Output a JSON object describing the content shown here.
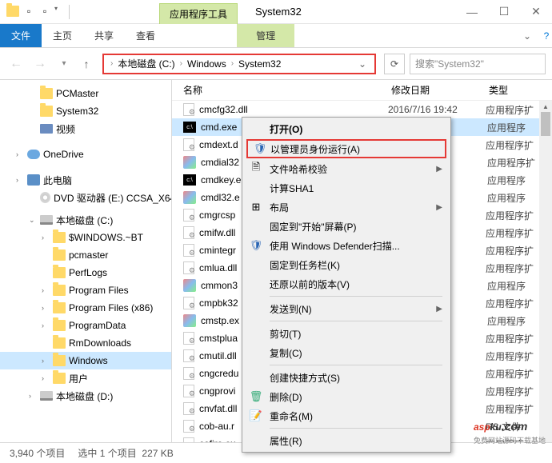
{
  "titlebar": {
    "tools_tab": "应用程序工具",
    "title": "System32"
  },
  "ribbon": {
    "file": "文件",
    "home": "主页",
    "share": "共享",
    "view": "查看",
    "manage": "管理"
  },
  "breadcrumb": {
    "seg1": "本地磁盘 (C:)",
    "seg2": "Windows",
    "seg3": "System32"
  },
  "search": {
    "placeholder": "搜索\"System32\""
  },
  "tree": {
    "pcmaster": "PCMaster",
    "system32": "System32",
    "video": "视频",
    "onedrive": "OneDrive",
    "thispc": "此电脑",
    "dvd": "DVD 驱动器 (E:) CCSA_X64",
    "localdisk": "本地磁盘 (C:)",
    "windowsbt": "$WINDOWS.~BT",
    "pcmaster2": "pcmaster",
    "perflogs": "PerfLogs",
    "progfiles": "Program Files",
    "progfiles86": "Program Files (x86)",
    "programdata": "ProgramData",
    "rmdl": "RmDownloads",
    "windows": "Windows",
    "users": "用户",
    "localdisk_d": "本地磁盘 (D:)"
  },
  "cols": {
    "name": "名称",
    "date": "修改日期",
    "type": "类型"
  },
  "files": [
    {
      "icon": "dll",
      "name": "cmcfg32.dll",
      "date": "2016/7/16 19:42",
      "type": "应用程序扩",
      "sel": false
    },
    {
      "icon": "exe",
      "name": "cmd.exe",
      "date": "",
      "type": "应用程序",
      "sel": true
    },
    {
      "icon": "dll",
      "name": "cmdext.d",
      "date": "",
      "type": "应用程序扩",
      "sel": false
    },
    {
      "icon": "app",
      "name": "cmdial32",
      "date": "",
      "type": "应用程序扩",
      "sel": false
    },
    {
      "icon": "exe",
      "name": "cmdkey.e",
      "date": "",
      "type": "应用程序",
      "sel": false
    },
    {
      "icon": "app",
      "name": "cmdl32.e",
      "date": "",
      "type": "应用程序",
      "sel": false
    },
    {
      "icon": "dll",
      "name": "cmgrcsp",
      "date": "",
      "type": "应用程序扩",
      "sel": false
    },
    {
      "icon": "dll",
      "name": "cmifw.dll",
      "date": "",
      "type": "应用程序扩",
      "sel": false
    },
    {
      "icon": "dll",
      "name": "cmintegr",
      "date": "",
      "type": "应用程序扩",
      "sel": false
    },
    {
      "icon": "dll",
      "name": "cmlua.dll",
      "date": "",
      "type": "应用程序扩",
      "sel": false
    },
    {
      "icon": "app",
      "name": "cmmon3",
      "date": "",
      "type": "应用程序",
      "sel": false
    },
    {
      "icon": "dll",
      "name": "cmpbk32",
      "date": "",
      "type": "应用程序扩",
      "sel": false
    },
    {
      "icon": "app",
      "name": "cmstp.ex",
      "date": "",
      "type": "应用程序",
      "sel": false
    },
    {
      "icon": "dll",
      "name": "cmstplua",
      "date": "",
      "type": "应用程序扩",
      "sel": false
    },
    {
      "icon": "dll",
      "name": "cmutil.dll",
      "date": "",
      "type": "应用程序扩",
      "sel": false
    },
    {
      "icon": "dll",
      "name": "cngcredu",
      "date": "",
      "type": "应用程序扩",
      "sel": false
    },
    {
      "icon": "dll",
      "name": "cngprovi",
      "date": "",
      "type": "应用程序扩",
      "sel": false
    },
    {
      "icon": "dll",
      "name": "cnvfat.dll",
      "date": "",
      "type": "应用程序扩",
      "sel": false
    },
    {
      "icon": "dll",
      "name": "cob-au.r",
      "date": "",
      "type": "RS 文件",
      "sel": false
    },
    {
      "icon": "dll",
      "name": "cofire.ex",
      "date": "",
      "type": "应用程序",
      "sel": false
    }
  ],
  "menu": {
    "open": "打开(O)",
    "runas": "以管理员身份运行(A)",
    "hash": "文件哈希校验",
    "sha1": "计算SHA1",
    "layout": "布局",
    "pin_start": "固定到\"开始\"屏幕(P)",
    "defender": "使用 Windows Defender扫描...",
    "pin_taskbar": "固定到任务栏(K)",
    "restore": "还原以前的版本(V)",
    "sendto": "发送到(N)",
    "cut": "剪切(T)",
    "copy": "复制(C)",
    "shortcut": "创建快捷方式(S)",
    "delete": "删除(D)",
    "rename": "重命名(M)",
    "props": "属性(R)"
  },
  "status": {
    "count": "3,940 个项目",
    "sel": "选中 1 个项目",
    "size": "227 KB"
  },
  "watermark": {
    "brand1": "asp",
    "brand2": "ku",
    "suffix": ".com",
    "sub": "免费网站源码下载基地"
  }
}
